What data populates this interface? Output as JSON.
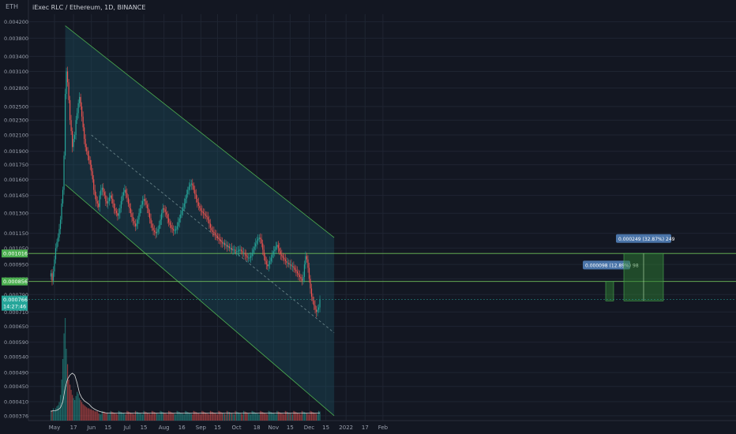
{
  "header": {
    "currency": "ETH",
    "title": "iExec RLC / Ethereum, 1D, BINANCE"
  },
  "colors": {
    "background": "#131722",
    "grid": "#1f2532",
    "up": "#26a69a",
    "down": "#ef5350",
    "channel": "#4caf50",
    "channel_fill": "#1a4a58",
    "hline": "#6fbf5a",
    "target_box": "#2e7d32",
    "label_bg": "#4a74a8",
    "price_tag": "#26a69a",
    "level_tag": "#4caf50",
    "volume_ma": "#dddddd",
    "axis_text": "#9aa0ad"
  },
  "chart_data": {
    "type": "candlestick",
    "title": "iExec RLC / Ethereum, 1D, BINANCE",
    "y_ticks": [
      "0.004200",
      "0.003800",
      "0.003400",
      "0.003100",
      "0.002800",
      "0.002500",
      "0.002300",
      "0.002100",
      "0.001900",
      "0.001750",
      "0.001600",
      "0.001450",
      "0.001300",
      "0.001150",
      "0.001050",
      "0.000950",
      "0.000870",
      "0.000790",
      "0.000710",
      "0.000650",
      "0.000590",
      "0.000540",
      "0.000490",
      "0.000450",
      "0.000410",
      "0.000376"
    ],
    "x_ticks": [
      "May",
      "17",
      "Jun",
      "15",
      "Jul",
      "15",
      "Aug",
      "16",
      "Sep",
      "15",
      "Oct",
      "18",
      "Nov",
      "15",
      "Dec",
      "15",
      "2022",
      "17",
      "Feb"
    ],
    "y_scale": "log",
    "ylim": [
      0.000365,
      0.0044
    ],
    "candles": {
      "start": "2021-04-28",
      "close": [
        0.0009,
        0.00086,
        0.00091,
        0.00098,
        0.00105,
        0.00109,
        0.00112,
        0.00118,
        0.00125,
        0.00138,
        0.0015,
        0.00185,
        0.0027,
        0.0031,
        0.0029,
        0.0026,
        0.0023,
        0.00215,
        0.00195,
        0.00205,
        0.0021,
        0.0023,
        0.0024,
        0.00255,
        0.00265,
        0.0025,
        0.00235,
        0.0022,
        0.00205,
        0.00195,
        0.0019,
        0.00185,
        0.0018,
        0.00175,
        0.00168,
        0.0016,
        0.0015,
        0.00145,
        0.0014,
        0.00138,
        0.00135,
        0.00145,
        0.0015,
        0.00152,
        0.00148,
        0.00145,
        0.0014,
        0.00138,
        0.0014,
        0.00143,
        0.00145,
        0.00142,
        0.00138,
        0.00134,
        0.00132,
        0.0013,
        0.00128,
        0.0013,
        0.00134,
        0.0014,
        0.00145,
        0.00148,
        0.0015,
        0.00147,
        0.00143,
        0.00138,
        0.00134,
        0.0013,
        0.00127,
        0.00124,
        0.00122,
        0.0012,
        0.00122,
        0.00125,
        0.0013,
        0.00134,
        0.00137,
        0.0014,
        0.00142,
        0.0014,
        0.00137,
        0.00134,
        0.0013,
        0.00126,
        0.00122,
        0.00119,
        0.00117,
        0.00116,
        0.00115,
        0.00116,
        0.00118,
        0.00121,
        0.00125,
        0.0013,
        0.00134,
        0.00133,
        0.00131,
        0.00129,
        0.00126,
        0.00123,
        0.00121,
        0.00119,
        0.00118,
        0.00117,
        0.00117,
        0.00118,
        0.0012,
        0.00123,
        0.00126,
        0.00129,
        0.00132,
        0.00135,
        0.00138,
        0.00142,
        0.00146,
        0.0015,
        0.00153,
        0.00155,
        0.00156,
        0.00154,
        0.0015,
        0.00146,
        0.00142,
        0.00139,
        0.00136,
        0.00134,
        0.00132,
        0.00131,
        0.0013,
        0.00129,
        0.00128,
        0.00127,
        0.00125,
        0.00122,
        0.00119,
        0.00117,
        0.00116,
        0.00115,
        0.00114,
        0.00113,
        0.00112,
        0.00111,
        0.0011,
        0.00109,
        0.00108,
        0.00108,
        0.00107,
        0.00107,
        0.00106,
        0.00106,
        0.00105,
        0.00105,
        0.00104,
        0.00104,
        0.00104,
        0.00103,
        0.00103,
        0.00103,
        0.00104,
        0.00104,
        0.00103,
        0.00102,
        0.00102,
        0.00101,
        0.001,
        0.00099,
        0.00099,
        0.00099,
        0.001,
        0.00102,
        0.00104,
        0.00106,
        0.00108,
        0.0011,
        0.00111,
        0.00112,
        0.00111,
        0.00108,
        0.00104,
        0.001,
        0.00097,
        0.00095,
        0.00094,
        0.00095,
        0.00097,
        0.00099,
        0.00101,
        0.00103,
        0.00104,
        0.00106,
        0.00107,
        0.00105,
        0.00103,
        0.00101,
        0.001,
        0.00099,
        0.00098,
        0.00097,
        0.00096,
        0.00096,
        0.00095,
        0.00095,
        0.00094,
        0.00094,
        0.00093,
        0.00092,
        0.00091,
        0.0009,
        0.00089,
        0.00088,
        0.00087,
        0.00086,
        0.00088,
        0.00095,
        0.001,
        0.00098,
        0.00093,
        0.00087,
        0.00082,
        0.00078,
        0.00076,
        0.00074,
        0.00072,
        0.00071,
        0.00072,
        0.00073,
        0.000766
      ],
      "volume_relative": [
        0.1,
        0.1,
        0.12,
        0.1,
        0.12,
        0.14,
        0.15,
        0.18,
        0.25,
        0.4,
        0.6,
        0.85,
        1.0,
        0.7,
        0.55,
        0.4,
        0.35,
        0.3,
        0.25,
        0.22,
        0.2,
        0.24,
        0.28,
        0.26,
        0.22,
        0.2,
        0.18,
        0.16,
        0.15,
        0.14,
        0.13,
        0.12,
        0.12,
        0.11,
        0.11,
        0.1,
        0.1,
        0.09,
        0.09,
        0.09
      ]
    },
    "current_price": "0.000766",
    "countdown": "14:27:46",
    "levels": [
      {
        "price": "0.001016",
        "label": "0.001016"
      },
      {
        "price": "0.000856",
        "label": "0.000856"
      }
    ],
    "channel": {
      "upper_line": [
        [
          "2021-05-10",
          0.0041
        ],
        [
          "2021-12-22",
          0.00112
        ]
      ],
      "lower_line": [
        [
          "2021-05-10",
          0.00155
        ],
        [
          "2021-12-22",
          0.000376
        ]
      ],
      "median_line": [
        [
          "2021-06-01",
          0.0021
        ],
        [
          "2021-12-22",
          0.000625
        ]
      ]
    },
    "targets": [
      {
        "label": "0.000098 (12.89%) 98",
        "from": 0.00076,
        "to": 0.000856
      },
      {
        "label": "0.000249 (32.87%) 249",
        "from": 0.00076,
        "to": 0.001016
      }
    ]
  }
}
